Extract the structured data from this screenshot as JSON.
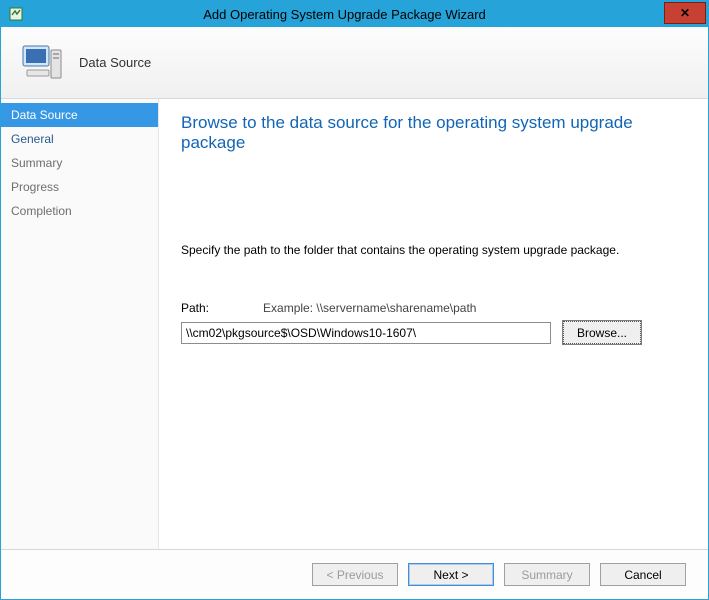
{
  "window": {
    "title": "Add Operating System Upgrade Package Wizard"
  },
  "banner": {
    "step_title": "Data Source"
  },
  "sidebar": {
    "items": [
      {
        "label": "Data Source",
        "state": "active"
      },
      {
        "label": "General",
        "state": "enabled"
      },
      {
        "label": "Summary",
        "state": "disabled"
      },
      {
        "label": "Progress",
        "state": "disabled"
      },
      {
        "label": "Completion",
        "state": "disabled"
      }
    ]
  },
  "main": {
    "heading": "Browse to the data source for the operating system upgrade package",
    "instruction": "Specify the path to the folder that contains the operating system upgrade package.",
    "path_label": "Path:",
    "example_label": "Example:  \\\\servername\\sharename\\path",
    "path_value": "\\\\cm02\\pkgsource$\\OSD\\Windows10-1607\\",
    "browse_label": "Browse..."
  },
  "footer": {
    "previous": "< Previous",
    "next": "Next >",
    "summary": "Summary",
    "cancel": "Cancel"
  }
}
